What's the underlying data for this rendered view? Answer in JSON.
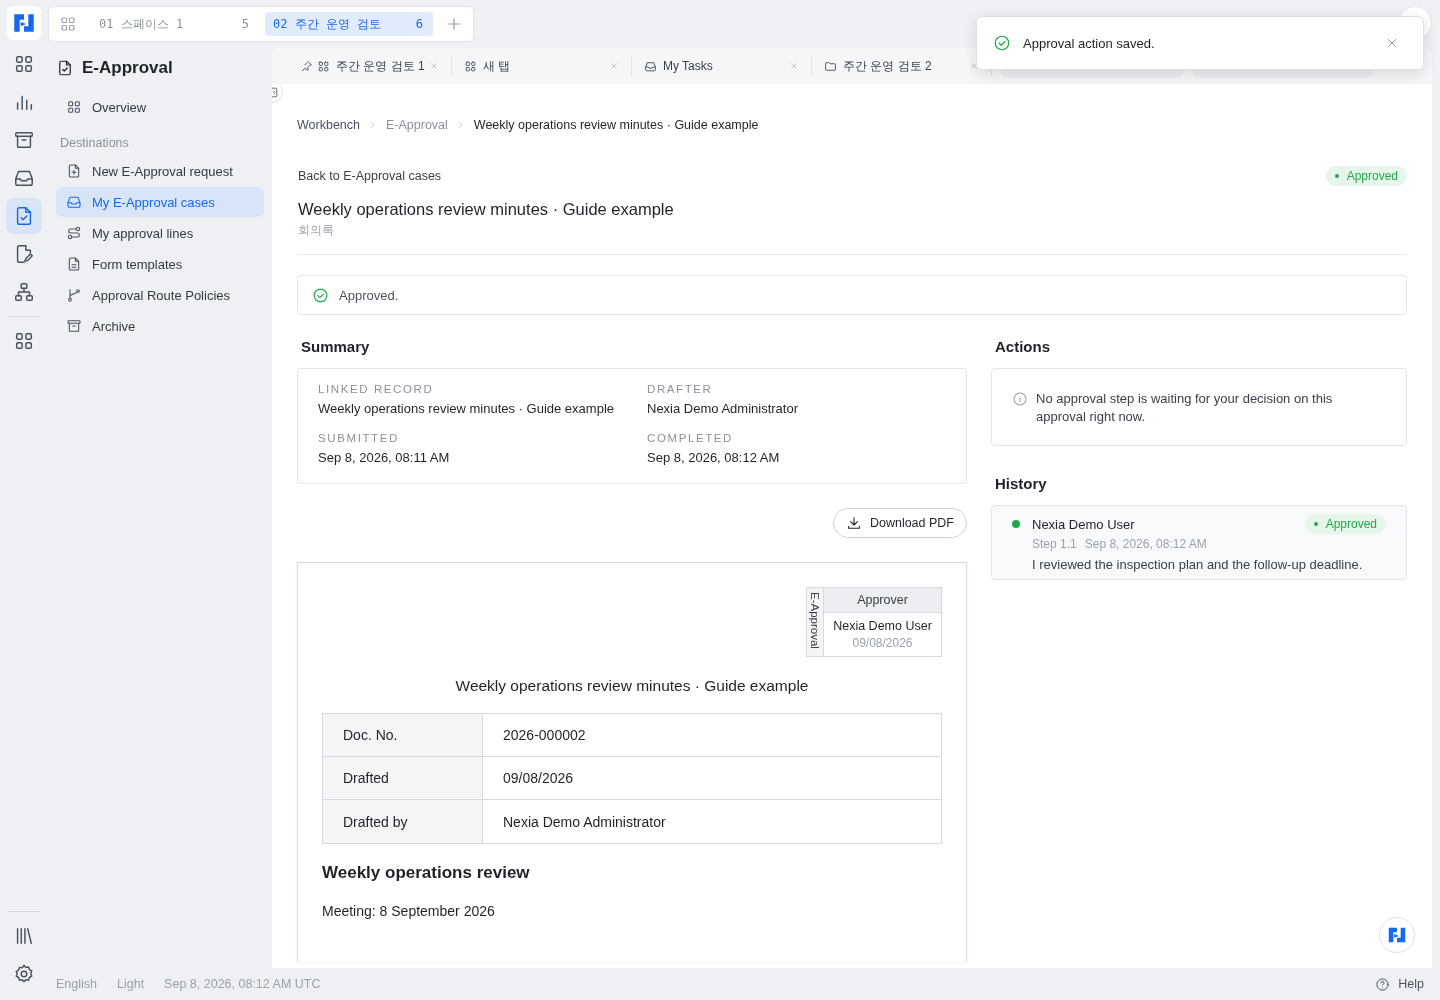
{
  "spaces": [
    {
      "label": "01 스페이스 1",
      "count": "5",
      "selected": false
    },
    {
      "label": "02 주간 운영 검토",
      "count": "6",
      "selected": true
    }
  ],
  "rail": {
    "items": [
      {
        "selected": false
      },
      {
        "selected": false
      },
      {
        "selected": false
      },
      {
        "selected": false
      },
      {
        "selected": true
      },
      {
        "selected": false
      },
      {
        "selected": false
      },
      {
        "selected": false
      }
    ]
  },
  "sidebar": {
    "title": "E-Approval",
    "overview": "Overview",
    "section": "Destinations",
    "items": [
      {
        "label": "New E-Approval request",
        "selected": false
      },
      {
        "label": "My E-Approval cases",
        "selected": true
      },
      {
        "label": "My approval lines",
        "selected": false
      },
      {
        "label": "Form templates",
        "selected": false
      },
      {
        "label": "Approval Route Policies",
        "selected": false
      },
      {
        "label": "Archive",
        "selected": false
      }
    ]
  },
  "doc_tabs": [
    {
      "label": "주간 운영 검토 1",
      "pinned": true
    },
    {
      "label": "새 탭",
      "pinned": false
    },
    {
      "label": "My Tasks",
      "pinned": false
    },
    {
      "label": "주간 운영 검토 2",
      "pinned": false
    }
  ],
  "toast": {
    "message": "Approval action saved."
  },
  "breadcrumb": [
    "Workbench",
    "E-Approval",
    "Weekly operations review minutes · Guide example"
  ],
  "header": {
    "back": "Back to E-Approval cases",
    "status": "Approved",
    "title": "Weekly operations review minutes · Guide example",
    "subtitle": "회의록"
  },
  "notice": "Approved.",
  "summary": {
    "title": "Summary",
    "fields": [
      {
        "label": "LINKED RECORD",
        "value": "Weekly operations review minutes · Guide example"
      },
      {
        "label": "DRAFTER",
        "value": "Nexia Demo Administrator"
      },
      {
        "label": "SUBMITTED",
        "value": "Sep 8, 2026, 08:11 AM"
      },
      {
        "label": "COMPLETED",
        "value": "Sep 8, 2026, 08:12 AM"
      }
    ],
    "download": "Download PDF"
  },
  "actions": {
    "title": "Actions",
    "info": "No approval step is waiting for your decision on this approval right now."
  },
  "history": {
    "title": "History",
    "entries": [
      {
        "name": "Nexia Demo User",
        "status": "Approved",
        "step": "Step 1.1",
        "time": "Sep 8, 2026, 08:12 AM",
        "comment": "I reviewed the inspection plan and the follow-up deadline."
      }
    ]
  },
  "document": {
    "stamp": {
      "side": "E-Approval",
      "role": "Approver",
      "name": "Nexia Demo User",
      "date": "09/08/2026"
    },
    "title": "Weekly operations review minutes · Guide example",
    "rows": [
      {
        "label": "Doc. No.",
        "value": "2026-000002"
      },
      {
        "label": "Drafted",
        "value": "09/08/2026"
      },
      {
        "label": "Drafted by",
        "value": "Nexia Demo Administrator"
      }
    ],
    "heading": "Weekly operations review",
    "line": "Meeting: 8 September 2026"
  },
  "footer": {
    "items": [
      "English",
      "Light",
      "Sep 8, 2026, 08:12 AM UTC"
    ],
    "help": "Help"
  }
}
